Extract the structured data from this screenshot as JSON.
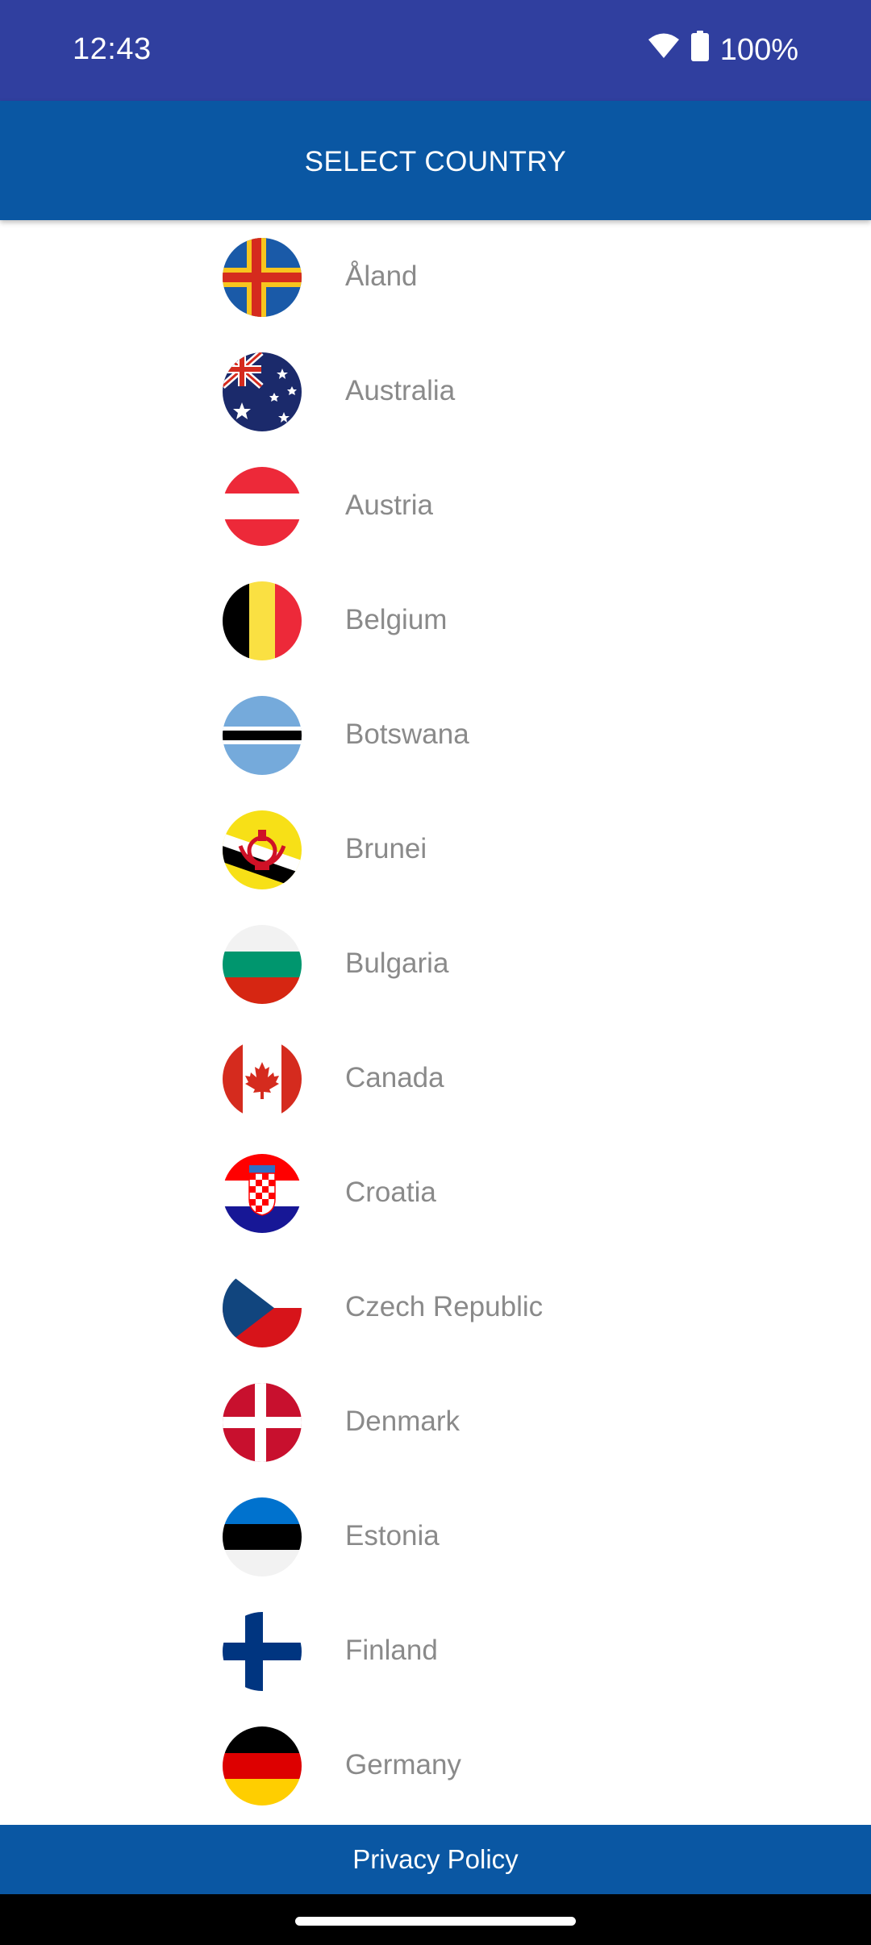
{
  "status_bar": {
    "time": "12:43",
    "battery": "100%",
    "icons": [
      "wifi-icon",
      "battery-icon"
    ]
  },
  "app_bar": {
    "title": "SELECT COUNTRY"
  },
  "countries": [
    {
      "name": "Åland",
      "flag_icon": "flag-aland-icon"
    },
    {
      "name": "Australia",
      "flag_icon": "flag-australia-icon"
    },
    {
      "name": "Austria",
      "flag_icon": "flag-austria-icon"
    },
    {
      "name": "Belgium",
      "flag_icon": "flag-belgium-icon"
    },
    {
      "name": "Botswana",
      "flag_icon": "flag-botswana-icon"
    },
    {
      "name": "Brunei",
      "flag_icon": "flag-brunei-icon"
    },
    {
      "name": "Bulgaria",
      "flag_icon": "flag-bulgaria-icon"
    },
    {
      "name": "Canada",
      "flag_icon": "flag-canada-icon"
    },
    {
      "name": "Croatia",
      "flag_icon": "flag-croatia-icon"
    },
    {
      "name": "Czech Republic",
      "flag_icon": "flag-czech-republic-icon"
    },
    {
      "name": "Denmark",
      "flag_icon": "flag-denmark-icon"
    },
    {
      "name": "Estonia",
      "flag_icon": "flag-estonia-icon"
    },
    {
      "name": "Finland",
      "flag_icon": "flag-finland-icon"
    },
    {
      "name": "Germany",
      "flag_icon": "flag-germany-icon"
    }
  ],
  "footer": {
    "link": "Privacy Policy"
  },
  "colors": {
    "status_bar": "#303f9f",
    "app_bar": "#0a57a3",
    "country_text": "#8a8a8a"
  }
}
